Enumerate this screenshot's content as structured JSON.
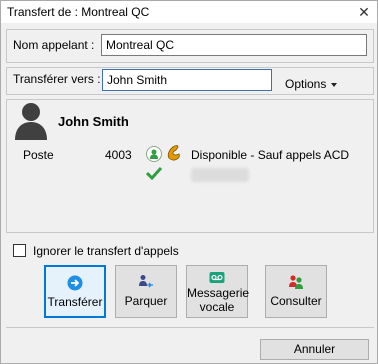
{
  "window": {
    "title": "Transfert de : Montreal QC",
    "close_glyph": "✕"
  },
  "caller": {
    "label": "Nom appelant :",
    "value": "Montreal QC"
  },
  "transfer": {
    "label": "Transférer vers :",
    "value": "John Smith",
    "options_label": "Options"
  },
  "contact": {
    "name": "John Smith",
    "poste_label": "Poste",
    "extension": "4003",
    "status_text": "Disponible - Sauf appels ACD"
  },
  "ignore_forward": {
    "label": "Ignorer le transfert d'appels",
    "checked": false
  },
  "actions": {
    "transfer_label": "Transférer",
    "park_label": "Parquer",
    "voicemail_line1": "Messagerie",
    "voicemail_line2": "vocale",
    "consult_label": "Consulter"
  },
  "cancel_label": "Annuler",
  "colors": {
    "accent": "#0078d7",
    "status_green": "#2e9e3e",
    "phone_orange": "#e59a00",
    "voicemail_teal": "#1aa37a"
  }
}
